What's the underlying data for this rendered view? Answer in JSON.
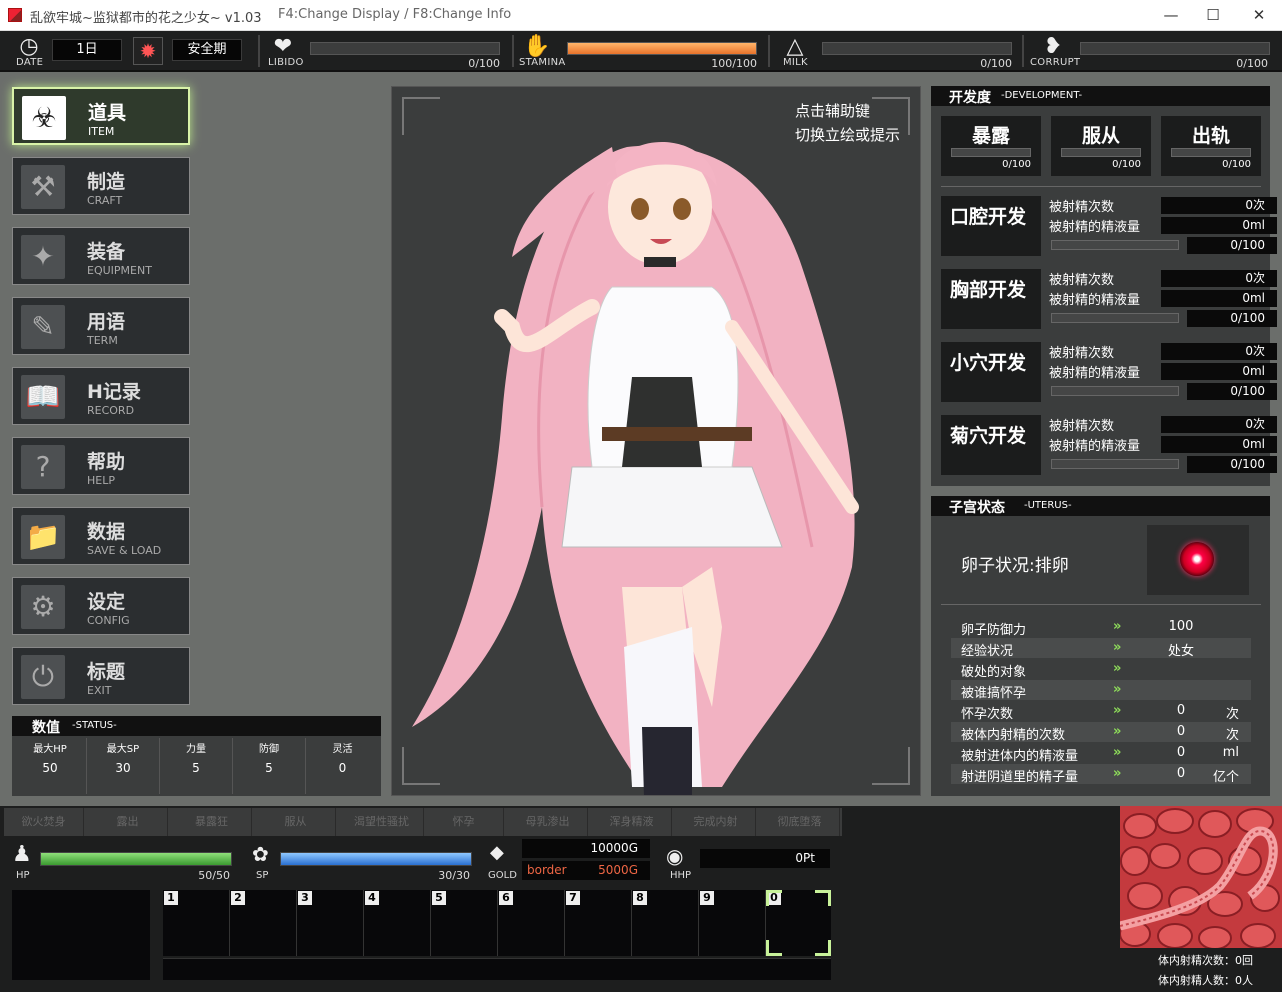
{
  "window": {
    "title": "乱欲牢城~监狱都市的花之少女~ v1.03",
    "hint": "F4:Change Display / F8:Change Info",
    "btn_min": "—",
    "btn_max": "☐",
    "btn_close": "✕"
  },
  "topbar": {
    "date_label": "DATE",
    "date_value": "1日",
    "period_value": "安全期",
    "libido_label": "LIBIDO",
    "libido_value": "0/100",
    "libido_fill": 0,
    "stamina_label": "STAMINA",
    "stamina_value": "100/100",
    "stamina_fill": 1,
    "milk_label": "MILK",
    "milk_value": "0/100",
    "milk_fill": 0,
    "corrupt_label": "CORRUPT",
    "corrupt_value": "0/100",
    "corrupt_fill": 0
  },
  "menu": [
    {
      "zh": "道具",
      "en": "ITEM",
      "icon": "potion-icon",
      "active": true
    },
    {
      "zh": "制造",
      "en": "CRAFT",
      "icon": "hammer-icon",
      "active": false
    },
    {
      "zh": "装备",
      "en": "EQUIPMENT",
      "icon": "wand-icon",
      "active": false
    },
    {
      "zh": "用语",
      "en": "TERM",
      "icon": "note-icon",
      "active": false
    },
    {
      "zh": "H记录",
      "en": "RECORD",
      "icon": "book-icon",
      "active": false
    },
    {
      "zh": "帮助",
      "en": "HELP",
      "icon": "question-icon",
      "active": false
    },
    {
      "zh": "数据",
      "en": "SAVE & LOAD",
      "icon": "folder-icon",
      "active": false
    },
    {
      "zh": "设定",
      "en": "CONFIG",
      "icon": "gear-icon",
      "active": false
    },
    {
      "zh": "标题",
      "en": "EXIT",
      "icon": "power-icon",
      "active": false
    }
  ],
  "status": {
    "title": "数值",
    "subtitle": "-STATUS-",
    "stats": [
      {
        "k": "最大HP",
        "v": "50"
      },
      {
        "k": "最大SP",
        "v": "30"
      },
      {
        "k": "力量",
        "v": "5"
      },
      {
        "k": "防御",
        "v": "5"
      },
      {
        "k": "灵活",
        "v": "0"
      }
    ]
  },
  "portrait": {
    "hint_line1": "点击辅助键",
    "hint_line2": "切换立绘或提示"
  },
  "development": {
    "title": "开发度",
    "subtitle": "-DEVELOPMENT-",
    "top": [
      {
        "name": "暴露",
        "value": "0/100"
      },
      {
        "name": "服从",
        "value": "0/100"
      },
      {
        "name": "出轨",
        "value": "0/100"
      }
    ],
    "label_times": "被射精次数",
    "label_amount": "被射精的精液量",
    "rows": [
      {
        "name": "口腔开发",
        "times": "0次",
        "amount": "0ml",
        "value": "0/100"
      },
      {
        "name": "胸部开发",
        "times": "0次",
        "amount": "0ml",
        "value": "0/100"
      },
      {
        "name": "小穴开发",
        "times": "0次",
        "amount": "0ml",
        "value": "0/100"
      },
      {
        "name": "菊穴开发",
        "times": "0次",
        "amount": "0ml",
        "value": "0/100"
      }
    ]
  },
  "uterus": {
    "title": "子宫状态",
    "subtitle": "-UTERUS-",
    "egg_status": "卵子状况:排卵",
    "rows": [
      {
        "k": "卵子防御力",
        "v": "100",
        "u": ""
      },
      {
        "k": "经验状况",
        "v": "处女",
        "u": ""
      },
      {
        "k": "破处的对象",
        "v": "",
        "u": ""
      },
      {
        "k": "被谁搞怀孕",
        "v": "",
        "u": ""
      },
      {
        "k": "怀孕次数",
        "v": "0",
        "u": "次"
      },
      {
        "k": "被体内射精的次数",
        "v": "0",
        "u": "次"
      },
      {
        "k": "被射进体内的精液量",
        "v": "0",
        "u": "ml"
      },
      {
        "k": "射进阴道里的精子量",
        "v": "0",
        "u": "亿个"
      }
    ]
  },
  "bottom": {
    "tags": [
      "欲火焚身",
      "露出",
      "暴露狂",
      "服从",
      "渴望性骚扰",
      "怀孕",
      "母乳渗出",
      "浑身精液",
      "完成内射",
      "彻底堕落"
    ],
    "hp_label": "HP",
    "hp_value": "50/50",
    "hp_fill": 1,
    "sp_label": "SP",
    "sp_value": "30/30",
    "sp_fill": 1,
    "gold_label": "GOLD",
    "gold_value": "10000G",
    "border_label": "border",
    "border_value": "5000G",
    "hhp_label": "HHP",
    "hhp_value": "0Pt",
    "slots": [
      "1",
      "2",
      "3",
      "4",
      "5",
      "6",
      "7",
      "8",
      "9",
      "0"
    ],
    "inner_times": "体内射精次数：0回",
    "inner_people": "体内射精人数：0人"
  }
}
